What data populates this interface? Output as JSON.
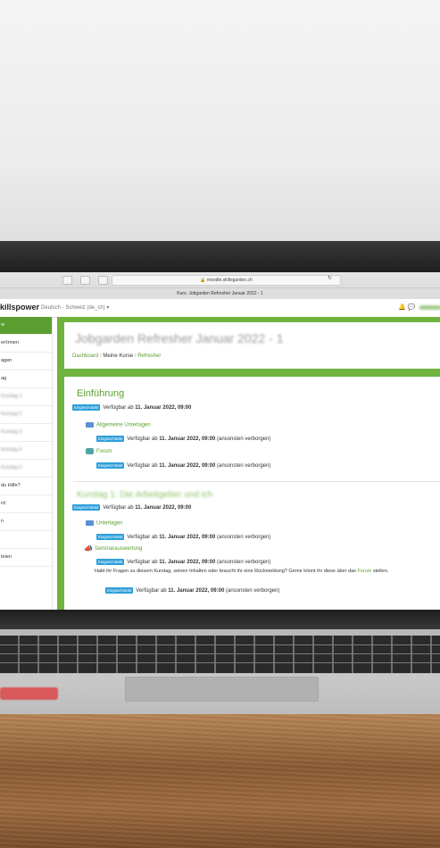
{
  "browser": {
    "url": "moodle.skillsgarden.ch",
    "tab_title": "Kurs: Jobgarden Refresher Januar 2022 - 1",
    "lock_icon": "lock-icon",
    "reload_icon": "reload-icon"
  },
  "navbar": {
    "brand": "killspower",
    "language": "Deutsch - Schweiz (de_ch) ▾",
    "icons": [
      "bell-icon",
      "chat-icon"
    ]
  },
  "sidebar": {
    "items": [
      {
        "label": "w"
      },
      {
        "label": "er/innen"
      },
      {
        "label": "agen"
      },
      {
        "label": "ag"
      },
      {
        "label": "Kurstag 1"
      },
      {
        "label": "Kurstag 2"
      },
      {
        "label": "Kurstag 3"
      },
      {
        "label": "Kurstag 4"
      },
      {
        "label": "Kurstag 5"
      },
      {
        "label": " du Hilfe?"
      },
      {
        "label": "rd"
      },
      {
        "label": "n"
      },
      {
        "label": ""
      },
      {
        "label": "teien"
      }
    ]
  },
  "course": {
    "title": "Jobgarden Refresher Januar 2022 - 1",
    "breadcrumb": {
      "dashboard": "Dashboard",
      "sep": "/",
      "my_courses": "Meine Kurse",
      "current": "Refresher"
    }
  },
  "sections": {
    "intro": {
      "title": "Einführung",
      "restriction": {
        "badge": "Eingeschränkt",
        "text": "Verfügbar ab",
        "date": "11. Januar 2022, 09:00"
      },
      "activities": [
        {
          "name": "Allgemeine Unterlagen",
          "icon": "folder-icon",
          "restriction": {
            "badge": "Eingeschränkt",
            "text": "Verfügbar ab",
            "date": "11. Januar 2022, 09:00",
            "suffix": "(ansonsten verborgen)"
          }
        },
        {
          "name": "Forum",
          "icon": "forum-icon",
          "restriction": {
            "badge": "Eingeschränkt",
            "text": "Verfügbar ab",
            "date": "11. Januar 2022, 09:00",
            "suffix": "(ansonsten verborgen)"
          }
        }
      ]
    },
    "day1": {
      "title": "Kurstag 1: Die Arbeitgeber und ich",
      "restriction": {
        "badge": "Eingeschränkt",
        "text": "Verfügbar ab",
        "date": "11. Januar 2022, 09:00"
      },
      "activities": [
        {
          "name": "Unterlagen",
          "icon": "folder-icon",
          "restriction": {
            "badge": "Eingeschränkt",
            "text": "Verfügbar ab",
            "date": "11. Januar 2022, 09:00",
            "suffix": "(ansonsten verborgen)"
          }
        },
        {
          "name": "Seminarauswertung",
          "icon": "feedback-icon",
          "restriction": {
            "badge": "Eingeschränkt",
            "text": "Verfügbar ab",
            "date": "11. Januar 2022, 09:00",
            "suffix": "(ansonsten verborgen)"
          }
        }
      ],
      "note_text": "Habt ihr Fragen zu diesem Kurstag, seinen Inhalten oder braucht ihr eine Rückmeldung? Gerne könnt ihr diese über das",
      "note_link": "Forum",
      "note_end": "stellen.",
      "note_restriction": {
        "badge": "Eingeschränkt",
        "text": "Verfügbar ab",
        "date": "11. Januar 2022, 09:00",
        "suffix": "(ansonsten verborgen)"
      }
    }
  }
}
